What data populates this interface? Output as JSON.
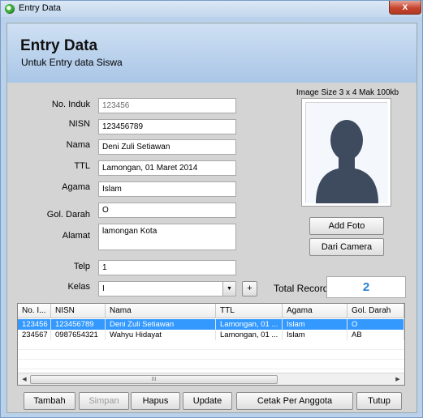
{
  "window": {
    "title": "Entry Data",
    "close": "x"
  },
  "header": {
    "title": "Entry Data",
    "subtitle": "Untuk Entry data Siswa"
  },
  "form": {
    "no_induk": {
      "label": "No. Induk",
      "value": "123456"
    },
    "nisn": {
      "label": "NISN",
      "value": "123456789"
    },
    "nama": {
      "label": "Nama",
      "value": "Deni Zuli Setiawan"
    },
    "ttl": {
      "label": "TTL",
      "value": "Lamongan, 01 Maret 2014"
    },
    "agama": {
      "label": "Agama",
      "value": "Islam"
    },
    "gol_darah": {
      "label": "Gol. Darah",
      "value": "O"
    },
    "alamat": {
      "label": "Alamat",
      "value": "lamongan Kota"
    },
    "telp": {
      "label": "Telp",
      "value": "1"
    },
    "kelas": {
      "label": "Kelas",
      "value": "I",
      "add": "+"
    }
  },
  "photo": {
    "caption": "Image Size 3 x 4 Mak 100kb",
    "add_foto": "Add Foto",
    "dari_camera": "Dari Camera"
  },
  "total": {
    "label": "Total Record",
    "value": "2"
  },
  "grid": {
    "columns": [
      "No. I...",
      "NISN",
      "Nama",
      "TTL",
      "Agama",
      "Gol. Darah"
    ],
    "rows": [
      [
        "123456",
        "123456789",
        "Deni Zuli Setiawan",
        "Lamongan, 01 ...",
        "Islam",
        "O"
      ],
      [
        "234567",
        "0987654321",
        "Wahyu Hidayat",
        "Lamongan, 01 ...",
        "Islam",
        "AB"
      ]
    ],
    "thumb_grip": "III"
  },
  "buttons": {
    "tambah": "Tambah",
    "simpan": "Simpan",
    "hapus": "Hapus",
    "update": "Update",
    "cetak": "Cetak Per Anggota",
    "tutup": "Tutup"
  },
  "colors": {
    "selection": "#3399ff",
    "header": "#b9d1ea",
    "total_value": "#2a7fd4"
  }
}
